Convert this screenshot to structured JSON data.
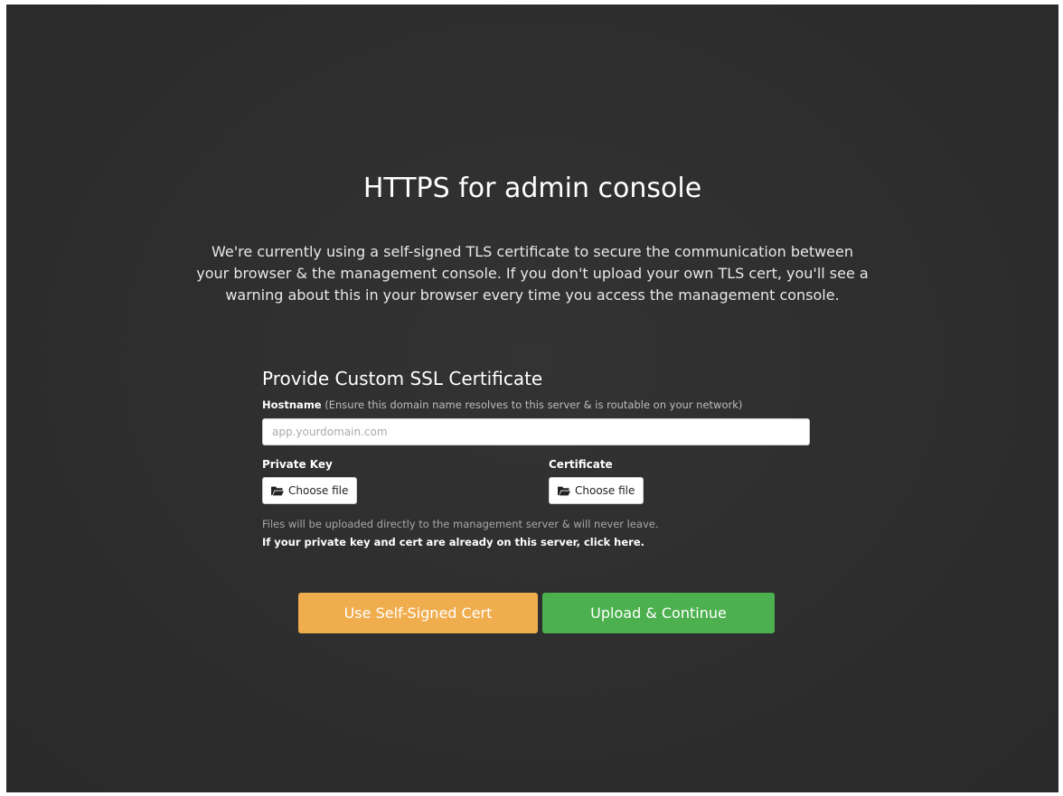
{
  "page": {
    "title": "HTTPS for admin console",
    "description": "We're currently using a self-signed TLS certificate to secure the communication between your browser & the management console. If you don't upload your own TLS cert, you'll see a warning about this in your browser every time you access the management console."
  },
  "form": {
    "title": "Provide Custom SSL Certificate",
    "hostname": {
      "label": "Hostname",
      "hint": "(Ensure this domain name resolves to this server & is routable on your network)",
      "placeholder": "app.yourdomain.com",
      "value": ""
    },
    "private_key": {
      "label": "Private Key",
      "button_label": "Choose file",
      "icon": "folder-open-icon"
    },
    "certificate": {
      "label": "Certificate",
      "button_label": "Choose file",
      "icon": "folder-open-icon"
    },
    "note": "Files will be uploaded directly to the management server & will never leave.",
    "server_link": "If your private key and cert are already on this server, click here."
  },
  "actions": {
    "self_signed_label": "Use Self-Signed Cert",
    "upload_label": "Upload & Continue"
  },
  "colors": {
    "background": "#2e2e2e",
    "warning_button": "#f0ad4e",
    "success_button": "#4cb04f"
  }
}
